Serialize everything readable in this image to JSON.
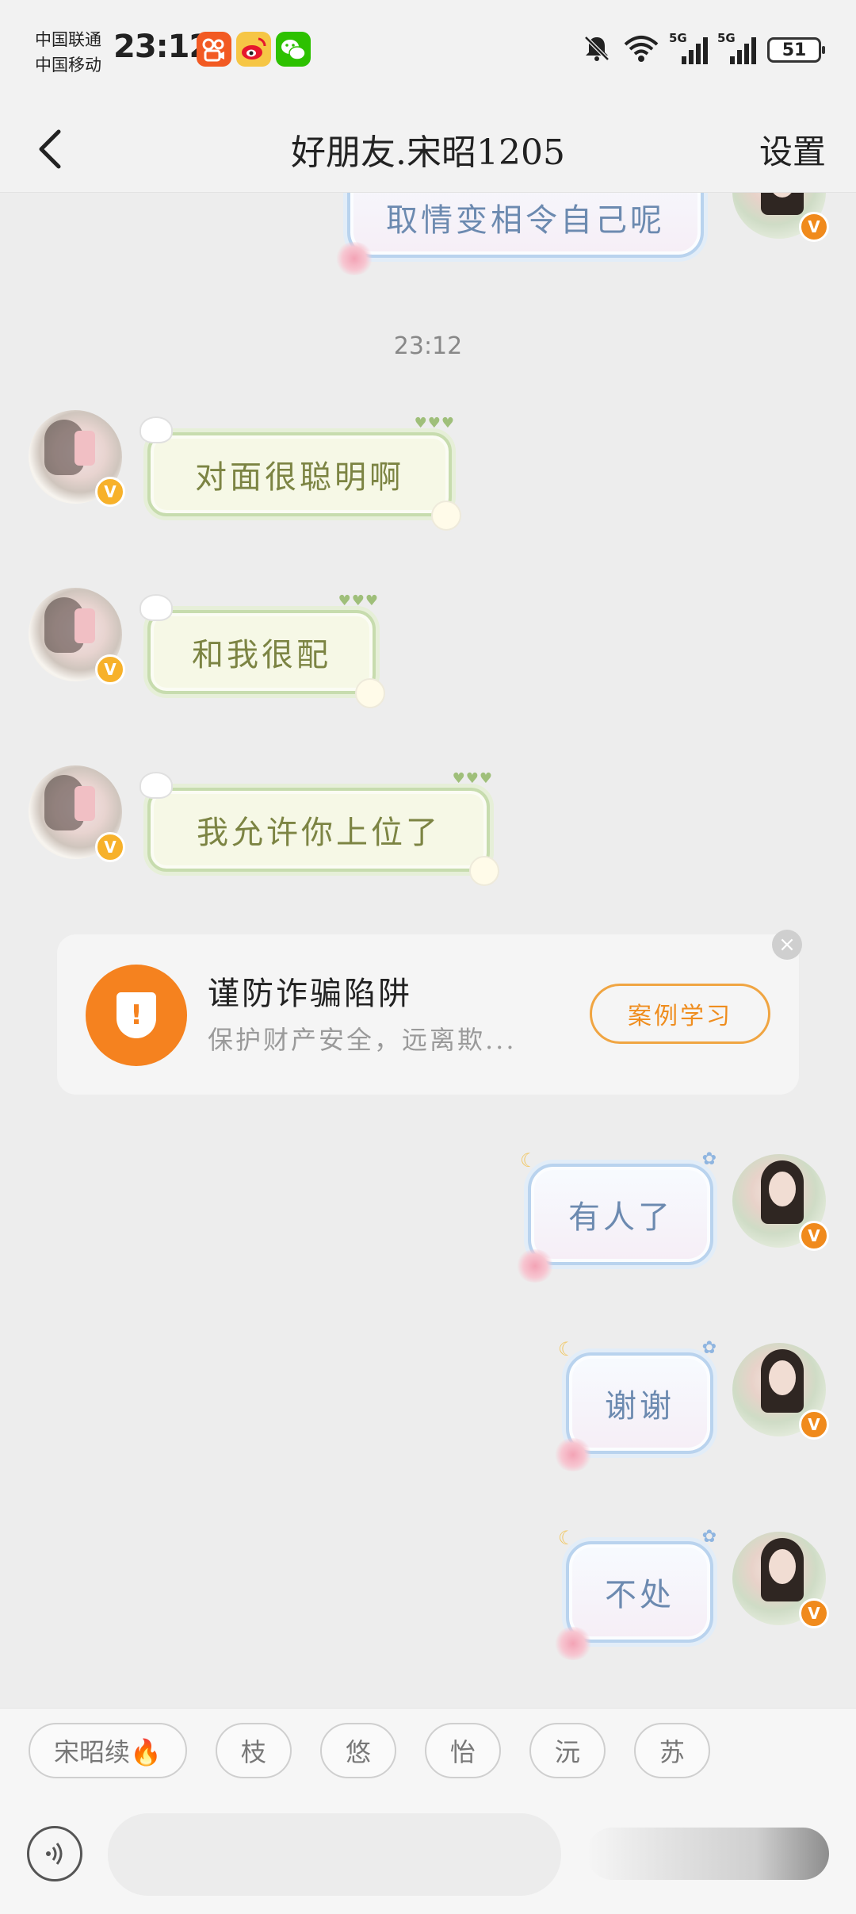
{
  "status_bar": {
    "carrier1": "中国联通",
    "carrier2": "中国移动",
    "time": "23:12",
    "signal_label1": "5G",
    "signal_label2": "5G",
    "battery": "51",
    "app_icons": [
      "kuaishou-icon",
      "weibo-icon",
      "wechat-icon"
    ]
  },
  "header": {
    "title": "好朋友.宋昭1205",
    "settings": "设置"
  },
  "chat": {
    "partial_message": "取情变相令自己呢",
    "time_divider": "23:12",
    "messages": [
      {
        "side": "left",
        "text": "对面很聪明啊"
      },
      {
        "side": "left",
        "text": "和我很配"
      },
      {
        "side": "left",
        "text": "我允许你上位了"
      },
      {
        "side": "right",
        "text": "有人了"
      },
      {
        "side": "right",
        "text": "谢谢"
      },
      {
        "side": "right",
        "text": "不处"
      }
    ],
    "fraud_card": {
      "title": "谨防诈骗陷阱",
      "subtitle": "保护财产安全，远离欺...",
      "button": "案例学习"
    }
  },
  "bottom": {
    "chips": [
      "宋昭续🔥",
      "枝",
      "悠",
      "怡",
      "沅",
      "苏"
    ],
    "input_placeholder": ""
  },
  "colors": {
    "accent_orange": "#f5821f",
    "left_bubble_text": "#7c8443",
    "right_bubble_text": "#6c8ab0",
    "background": "#ededed"
  }
}
